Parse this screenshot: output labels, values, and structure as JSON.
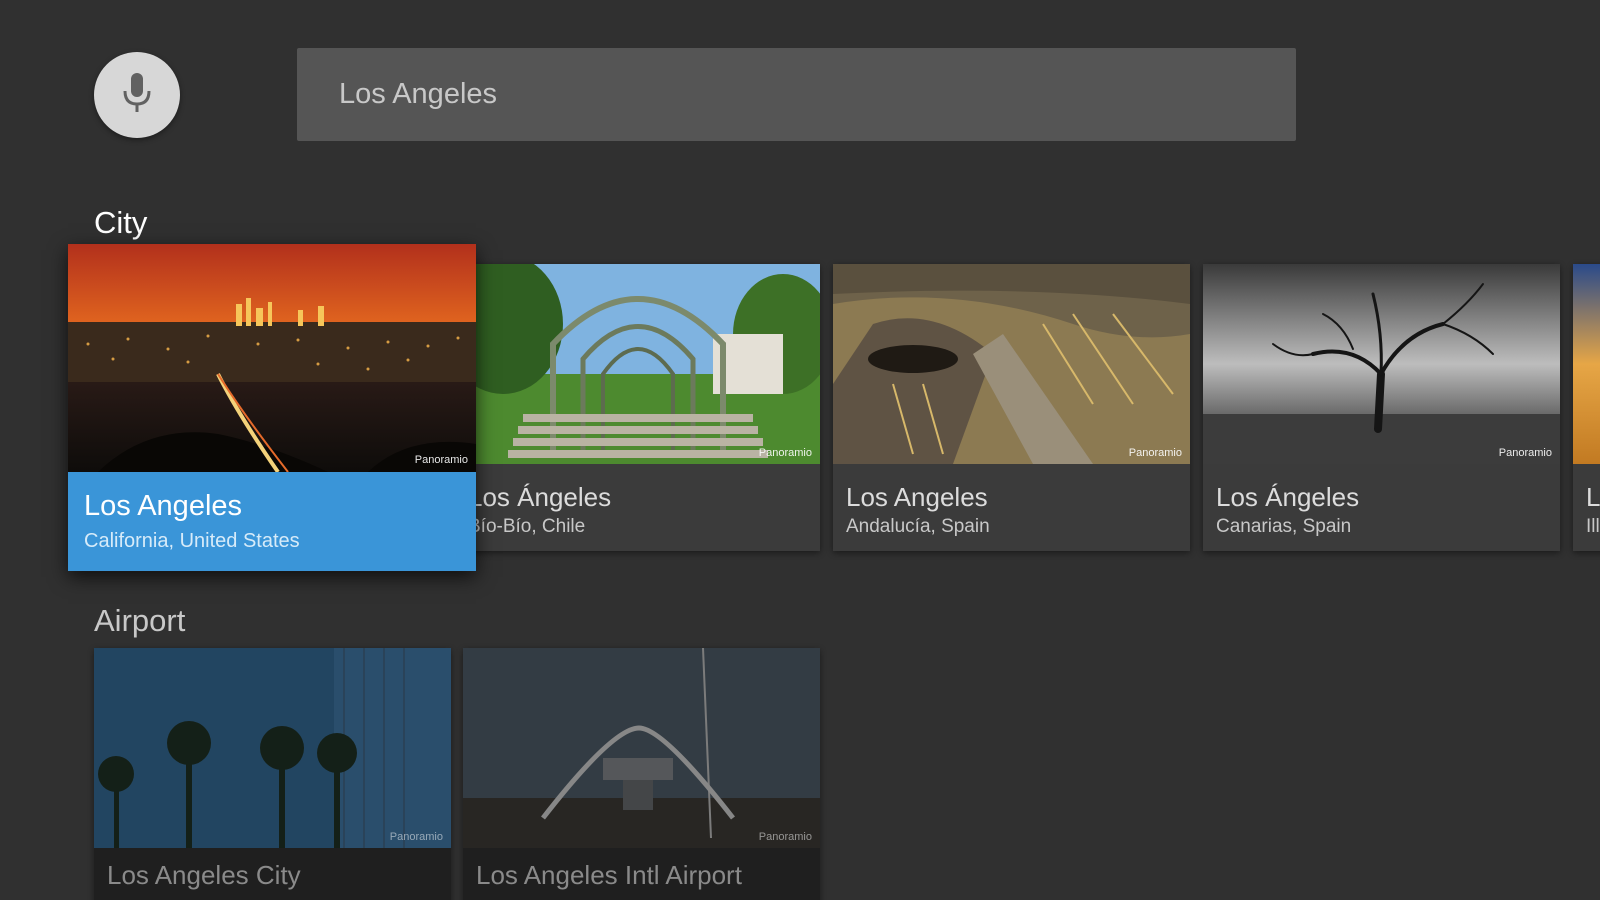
{
  "search": {
    "query": "Los Angeles"
  },
  "rows": [
    {
      "title": "City",
      "cards": [
        {
          "title": "Los Angeles",
          "subtitle": "California, United States",
          "watermark": "Panoramio",
          "focused": true
        },
        {
          "title": "Los Ángeles",
          "subtitle": "Bío-Bío, Chile",
          "watermark": "Panoramio"
        },
        {
          "title": "Los Angeles",
          "subtitle": "Andalucía, Spain",
          "watermark": "Panoramio"
        },
        {
          "title": "Los Ángeles",
          "subtitle": "Canarias, Spain",
          "watermark": "Panoramio"
        },
        {
          "title": "L",
          "subtitle": "Ill"
        }
      ]
    },
    {
      "title": "Airport",
      "cards": [
        {
          "title": "Los Angeles City",
          "watermark": "Panoramio"
        },
        {
          "title": "Los Angeles Intl Airport",
          "watermark": "Panoramio"
        }
      ]
    }
  ],
  "colors": {
    "background": "#303030",
    "focus_accent": "#3a95d8",
    "search_bar": "#555555",
    "mic_button": "#d7d7d7"
  },
  "icons": {
    "voice_search": "microphone-icon"
  }
}
